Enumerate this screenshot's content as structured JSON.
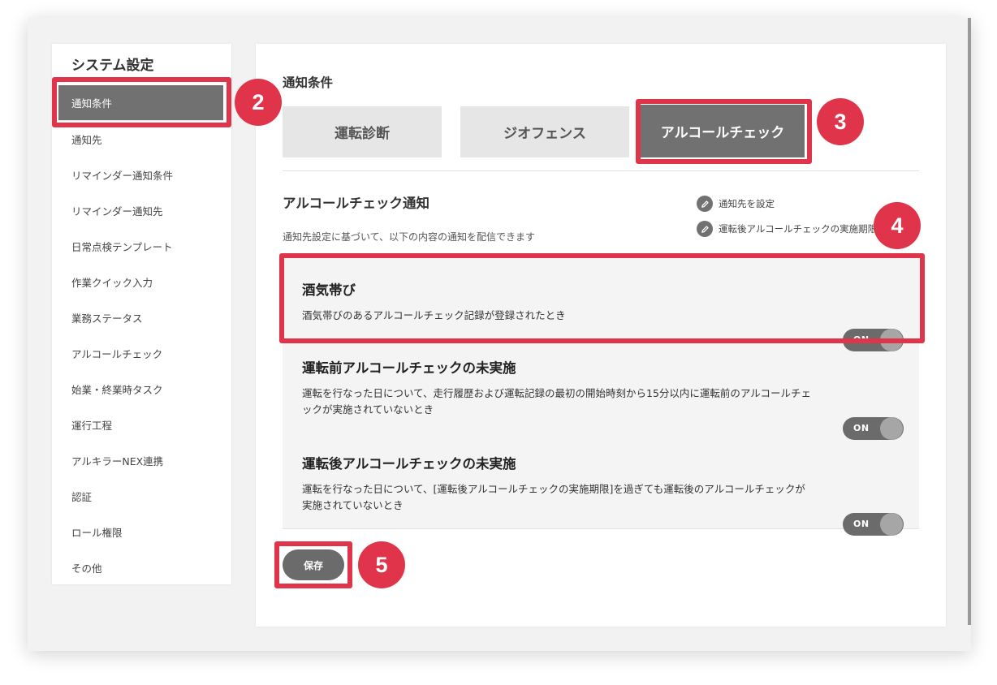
{
  "sidebar": {
    "title": "システム設定",
    "items": [
      {
        "label": "通知条件",
        "active": true
      },
      {
        "label": "通知先"
      },
      {
        "label": "リマインダー通知条件"
      },
      {
        "label": "リマインダー通知先"
      },
      {
        "label": "日常点検テンプレート"
      },
      {
        "label": "作業クイック入力"
      },
      {
        "label": "業務ステータス"
      },
      {
        "label": "アルコールチェック"
      },
      {
        "label": "始業・終業時タスク"
      },
      {
        "label": "運行工程"
      },
      {
        "label": "アルキラーNEX連携"
      },
      {
        "label": "認証"
      },
      {
        "label": "ロール権限"
      },
      {
        "label": "その他"
      }
    ]
  },
  "main": {
    "title": "通知条件",
    "tabs": [
      {
        "label": "運転診断"
      },
      {
        "label": "ジオフェンス"
      },
      {
        "label": "アルコールチェック",
        "active": true
      }
    ],
    "section": {
      "title": "アルコールチェック通知",
      "description": "通知先設定に基づいて、以下の内容の通知を配信できます",
      "links": [
        {
          "label": "通知先を設定",
          "icon": "pencil-icon"
        },
        {
          "label": "運転後アルコールチェックの実施期限",
          "icon": "pencil-icon"
        }
      ],
      "items": [
        {
          "title": "酒気帯び",
          "description": "酒気帯びのあるアルコールチェック記録が登録されたとき",
          "toggle": "ON"
        },
        {
          "title": "運転前アルコールチェックの未実施",
          "description": "運転を行なった日について、走行履歴および運転記録の最初の開始時刻から15分以内に運転前のアルコールチェックが実施されていないとき",
          "toggle": "ON"
        },
        {
          "title": "運転後アルコールチェックの未実施",
          "description": "運転を行なった日について、[運転後アルコールチェックの実施期限]を過ぎても運転後のアルコールチェックが実施されていないとき",
          "toggle": "ON"
        }
      ]
    },
    "save_label": "保存"
  },
  "callouts": [
    "2",
    "3",
    "4",
    "5"
  ],
  "colors": {
    "accent": "#e0344b",
    "active": "#717171",
    "tab_inactive": "#e6e6e6",
    "toggle_track": "#6b6b6b"
  }
}
